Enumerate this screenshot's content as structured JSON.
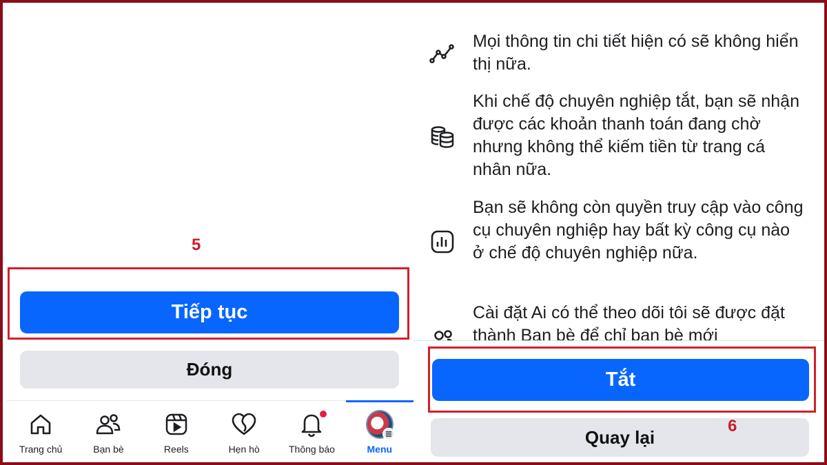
{
  "left": {
    "step_number": "5",
    "continue_label": "Tiếp tục",
    "close_label": "Đóng",
    "tabs": [
      {
        "label": "Trang chủ",
        "icon": "home-icon"
      },
      {
        "label": "Bạn bè",
        "icon": "friends-icon"
      },
      {
        "label": "Reels",
        "icon": "reels-icon"
      },
      {
        "label": "Hẹn hò",
        "icon": "dating-heart-icon"
      },
      {
        "label": "Thông báo",
        "icon": "bell-icon"
      },
      {
        "label": "Menu",
        "icon": "avatar-menu-icon"
      }
    ],
    "active_tab": "Menu"
  },
  "right": {
    "step_number": "6",
    "items": [
      {
        "icon": "insights-line-icon",
        "text": "Mọi thông tin chi tiết hiện có sẽ không hiển thị nữa."
      },
      {
        "icon": "coins-stack-icon",
        "text": "Khi chế độ chuyên nghiệp tắt, bạn sẽ nhận được các khoản thanh toán đang chờ nhưng không thể kiếm tiền từ trang cá nhân nữa."
      },
      {
        "icon": "dashboard-chart-icon",
        "text": "Bạn sẽ không còn quyền truy cập vào công cụ chuyên nghiệp hay bất kỳ công cụ nào ở chế độ chuyên nghiệp nữa."
      },
      {
        "icon": "people-icon",
        "text": "Cài đặt Ai có thể theo dõi tôi sẽ được đặt thành Bạn bè để chỉ bạn bè mới"
      }
    ],
    "turn_off_label": "Tắt",
    "back_label": "Quay lại"
  },
  "colors": {
    "primary": "#0866ff",
    "secondary_bg": "#e4e6eb",
    "highlight": "#d11f2c",
    "frame": "#8b0c1a",
    "notification": "#e41e3f"
  }
}
